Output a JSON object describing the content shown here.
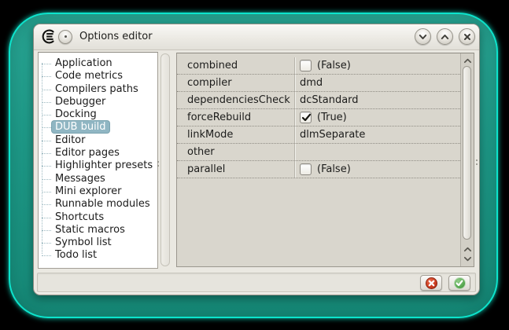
{
  "titlebar": {
    "title": "Options editor",
    "icons": [
      "app-logo-icon",
      "window-menu-icon",
      "chevron-down-icon",
      "chevron-up-icon",
      "close-icon"
    ]
  },
  "sidebar": {
    "items": [
      "Application",
      "Code metrics",
      "Compilers paths",
      "Debugger",
      "Docking",
      "DUB build",
      "Editor",
      "Editor pages",
      "Highlighter presets",
      "Messages",
      "Mini explorer",
      "Runnable modules",
      "Shortcuts",
      "Static macros",
      "Symbol list",
      "Todo list"
    ],
    "selected": "DUB build",
    "selected_index": 5
  },
  "properties": {
    "rows": [
      {
        "name": "combined",
        "editor": "checkbox",
        "checked": false,
        "value": "(False)"
      },
      {
        "name": "compiler",
        "editor": "text",
        "value": "dmd"
      },
      {
        "name": "dependenciesCheck",
        "editor": "text",
        "value": "dcStandard"
      },
      {
        "name": "forceRebuild",
        "editor": "checkbox",
        "checked": true,
        "value": "(True)"
      },
      {
        "name": "linkMode",
        "editor": "text",
        "value": "dlmSeparate"
      },
      {
        "name": "other",
        "editor": "text",
        "value": ""
      },
      {
        "name": "parallel",
        "editor": "checkbox",
        "checked": false,
        "value": "(False)"
      }
    ]
  },
  "footer": {
    "buttons": [
      {
        "icon": "cancel-circle-icon",
        "color": "#cb3b1f"
      },
      {
        "icon": "ok-check-circle-icon",
        "color": "#55a74f"
      }
    ]
  },
  "scrollbar": {
    "icons": [
      "chevron-up-icon",
      "chevron-up-icon",
      "chevron-down-icon"
    ]
  },
  "colors": {
    "desktop_fill": "#1f9c8a",
    "desktop_border": "#0ce4cc",
    "selection_bg": "#90b6c3",
    "window_bg": "#eae8e1",
    "grid_bg": "#d9d6cd"
  }
}
